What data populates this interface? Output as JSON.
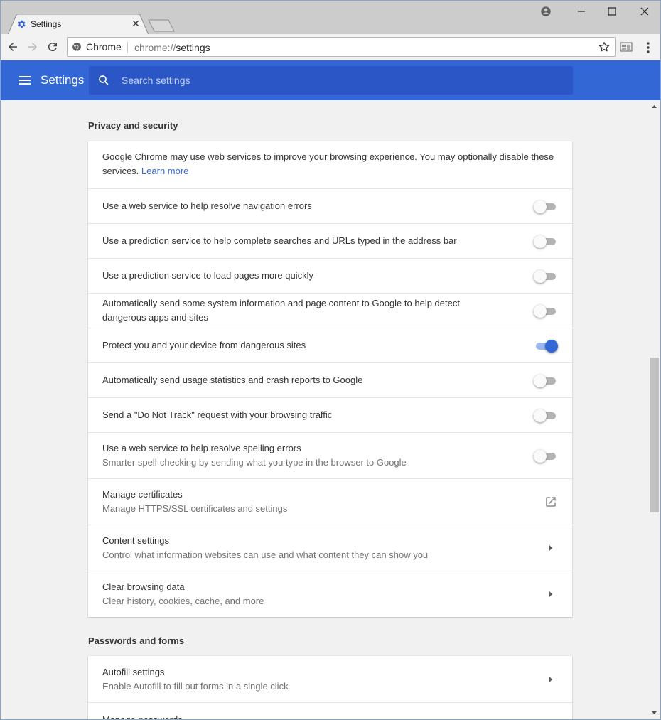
{
  "browser": {
    "tab_title": "Settings",
    "omnibox_chip": "Chrome",
    "url_scheme": "chrome://",
    "url_path": "settings"
  },
  "header": {
    "title": "Settings",
    "search_placeholder": "Search settings"
  },
  "privacy": {
    "heading": "Privacy and security",
    "intro_text": "Google Chrome may use web services to improve your browsing experience. You may optionally disable these services.",
    "intro_link": "Learn more",
    "toggles": [
      {
        "label": "Use a web service to help resolve navigation errors",
        "on": false
      },
      {
        "label": "Use a prediction service to help complete searches and URLs typed in the address bar",
        "on": false
      },
      {
        "label": "Use a prediction service to load pages more quickly",
        "on": false
      },
      {
        "label": "Automatically send some system information and page content to Google to help detect dangerous apps and sites",
        "on": false
      },
      {
        "label": "Protect you and your device from dangerous sites",
        "on": true
      },
      {
        "label": "Automatically send usage statistics and crash reports to Google",
        "on": false
      },
      {
        "label": "Send a \"Do Not Track\" request with your browsing traffic",
        "on": false
      }
    ],
    "spelling": {
      "label": "Use a web service to help resolve spelling errors",
      "sublabel": "Smarter spell-checking by sending what you type in the browser to Google",
      "on": false
    },
    "certificates": {
      "label": "Manage certificates",
      "sublabel": "Manage HTTPS/SSL certificates and settings"
    },
    "content_settings": {
      "label": "Content settings",
      "sublabel": "Control what information websites can use and what content they can show you"
    },
    "clear_data": {
      "label": "Clear browsing data",
      "sublabel": "Clear history, cookies, cache, and more"
    }
  },
  "passwords": {
    "heading": "Passwords and forms",
    "autofill": {
      "label": "Autofill settings",
      "sublabel": "Enable Autofill to fill out forms in a single click"
    },
    "manage_passwords": {
      "label": "Manage passwords"
    }
  },
  "colors": {
    "accent": "#3367d6",
    "header_bg": "#3367d6",
    "search_bg": "#2a56c6"
  }
}
